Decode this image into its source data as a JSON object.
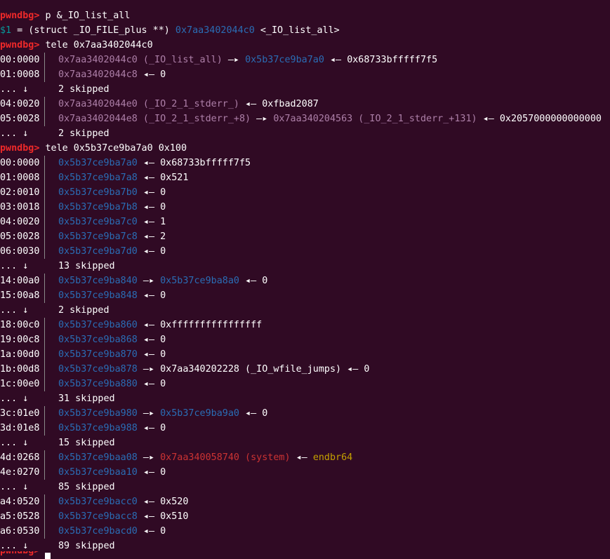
{
  "terminal": {
    "prompt": "pwndbg>",
    "cmd1": " p &_IO_list_all",
    "print_var": "$1",
    "print_mid": " = (struct _IO_FILE_plus **) ",
    "print_addr": "0x7aa3402044c0",
    "print_sym": " <_IO_list_all>",
    "cmd2": " tele 0x7aa3402044c0",
    "cmd3": " tele 0x5b37ce9ba7a0 0x100",
    "skip_prefix": "... ↓",
    "arrow_r": " —▸ ",
    "arrow_l": " ◂— "
  },
  "tele1": {
    "r0": {
      "idx": "00:0000",
      "addr": "0x7aa3402044c0",
      "sym": " (_IO_list_all)",
      "ptr": "0x5b37ce9ba7a0",
      "val": "0x68733bfffff7f5"
    },
    "r1": {
      "idx": "01:0008",
      "addr": "0x7aa3402044c8",
      "val": "0"
    },
    "s1": "2 skipped",
    "r2": {
      "idx": "04:0020",
      "addr": "0x7aa3402044e0",
      "sym": " (_IO_2_1_stderr_)",
      "val": "0xfbad2087"
    },
    "r3": {
      "idx": "05:0028",
      "addr": "0x7aa3402044e8",
      "sym": " (_IO_2_1_stderr_+8)",
      "ptr": "0x7aa340204563",
      "ptrsym": " (_IO_2_1_stderr_+131)",
      "val": "0x2057000000000000"
    },
    "s2": "2 skipped"
  },
  "tele2": {
    "r00": {
      "idx": "00:0000",
      "addr": "0x5b37ce9ba7a0",
      "val": "0x68733bfffff7f5"
    },
    "r01": {
      "idx": "01:0008",
      "addr": "0x5b37ce9ba7a8",
      "val": "0x521"
    },
    "r02": {
      "idx": "02:0010",
      "addr": "0x5b37ce9ba7b0",
      "val": "0"
    },
    "r03": {
      "idx": "03:0018",
      "addr": "0x5b37ce9ba7b8",
      "val": "0"
    },
    "r04": {
      "idx": "04:0020",
      "addr": "0x5b37ce9ba7c0",
      "val": "1"
    },
    "r05": {
      "idx": "05:0028",
      "addr": "0x5b37ce9ba7c8",
      "val": "2"
    },
    "r06": {
      "idx": "06:0030",
      "addr": "0x5b37ce9ba7d0",
      "val": "0"
    },
    "s1": "13 skipped",
    "r14": {
      "idx": "14:00a0",
      "addr": "0x5b37ce9ba840",
      "ptr": "0x5b37ce9ba8a0",
      "val": "0"
    },
    "r15": {
      "idx": "15:00a8",
      "addr": "0x5b37ce9ba848",
      "val": "0"
    },
    "s2": "2 skipped",
    "r18": {
      "idx": "18:00c0",
      "addr": "0x5b37ce9ba860",
      "val": "0xffffffffffffffff"
    },
    "r19": {
      "idx": "19:00c8",
      "addr": "0x5b37ce9ba868",
      "val": "0"
    },
    "r1a": {
      "idx": "1a:00d0",
      "addr": "0x5b37ce9ba870",
      "val": "0"
    },
    "r1b": {
      "idx": "1b:00d8",
      "addr": "0x5b37ce9ba878",
      "ptr": "0x7aa340202228 (_IO_wfile_jumps)",
      "val": "0"
    },
    "r1c": {
      "idx": "1c:00e0",
      "addr": "0x5b37ce9ba880",
      "val": "0"
    },
    "s3": "31 skipped",
    "r3c": {
      "idx": "3c:01e0",
      "addr": "0x5b37ce9ba980",
      "ptr": "0x5b37ce9ba9a0",
      "val": "0"
    },
    "r3d": {
      "idx": "3d:01e8",
      "addr": "0x5b37ce9ba988",
      "val": "0"
    },
    "s4": "15 skipped",
    "r4d": {
      "idx": "4d:0268",
      "addr": "0x5b37ce9baa08",
      "ptr": "0x7aa340058740 (system)",
      "val": "endbr64"
    },
    "r4e": {
      "idx": "4e:0270",
      "addr": "0x5b37ce9baa10",
      "val": "0"
    },
    "s5": "85 skipped",
    "ra4": {
      "idx": "a4:0520",
      "addr": "0x5b37ce9bacc0",
      "val": "0x520"
    },
    "ra5": {
      "idx": "a5:0528",
      "addr": "0x5b37ce9bacc8",
      "val": "0x510"
    },
    "ra6": {
      "idx": "a6:0530",
      "addr": "0x5b37ce9bacd0",
      "val": "0"
    },
    "s6": "89 skipped"
  },
  "colors": {
    "background": "#300a24",
    "prompt": "#ef2929",
    "heap": "#2a6db5",
    "libc": "#ad7fa8",
    "code": "#cc3333",
    "instr": "#c4a000"
  }
}
